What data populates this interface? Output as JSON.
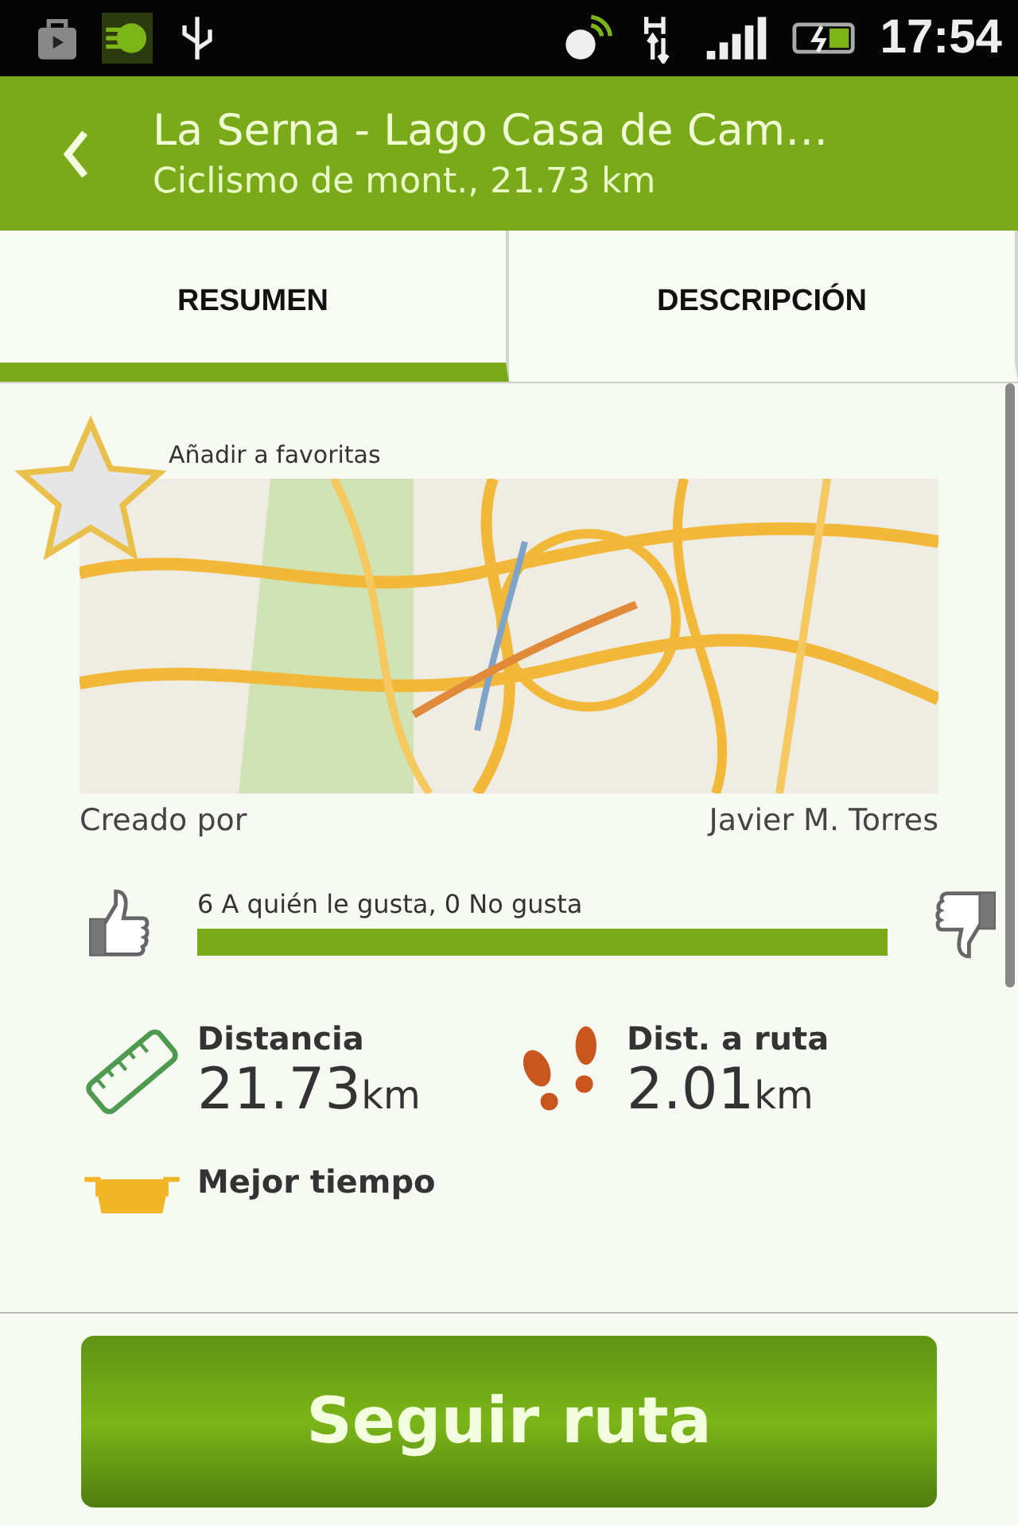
{
  "status_bar": {
    "time": "17:54"
  },
  "header": {
    "title": "La Serna - Lago Casa de Cam…",
    "subtitle": "Ciclismo de mont., 21.73 km"
  },
  "tabs": [
    {
      "label": "RESUMEN",
      "selected": true
    },
    {
      "label": "DESCRIPCIÓN",
      "selected": false
    }
  ],
  "favorite": {
    "label": "Añadir a favoritas",
    "selected": false
  },
  "creator": {
    "label": "Creado por",
    "name": "Javier M. Torres"
  },
  "likes": {
    "label": "6 A quién le gusta, 0 No gusta"
  },
  "stats": [
    {
      "kind": "distance",
      "label": "Distancia",
      "value": "21.73",
      "unit": "km"
    },
    {
      "kind": "footprints",
      "label": "Dist. a ruta",
      "value": "2.01",
      "unit": "km"
    },
    {
      "kind": "trophy",
      "label": "Mejor tiempo"
    }
  ],
  "action": {
    "label": "Seguir ruta"
  }
}
